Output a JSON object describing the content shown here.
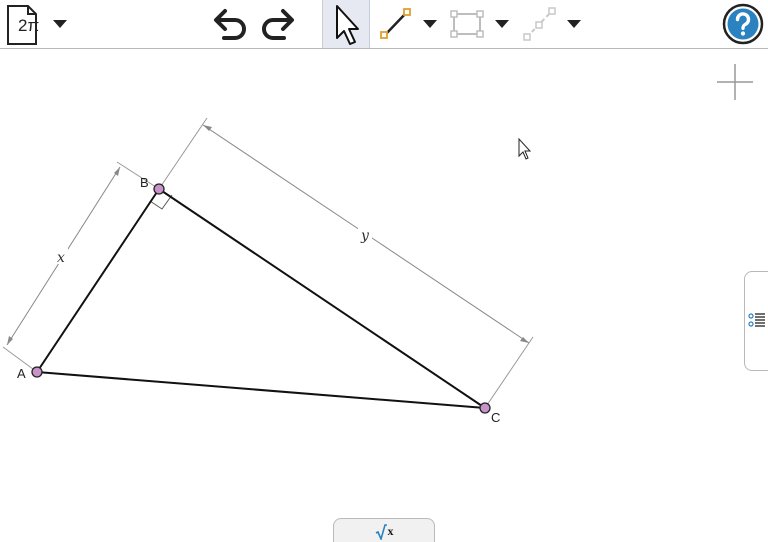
{
  "toolbar": {
    "document_label": "2π",
    "document_menu": "chevron-down-icon",
    "undo": "undo-icon",
    "redo": "redo-icon",
    "select_tool": "arrow-pointer-icon",
    "segment_tool": "segment-tool-icon",
    "transform_tool": "transform-tool-icon",
    "construct_tool": "construct-tool-icon",
    "help": "help-icon",
    "active_tool": "select"
  },
  "canvas": {
    "points": [
      {
        "name": "A",
        "color": "#c893c8"
      },
      {
        "name": "B",
        "color": "#c893c8"
      },
      {
        "name": "C",
        "color": "#c893c8"
      }
    ],
    "segments": [
      "AB",
      "BC",
      "CA"
    ],
    "right_angle_at": "B",
    "measurements": [
      {
        "label": "x",
        "side": "AB"
      },
      {
        "label": "y",
        "side": "BC"
      }
    ],
    "zoom_button": "plus-icon"
  },
  "side_panel": {
    "icon": "list-panel-icon"
  },
  "bottom_panel": {
    "label": "x",
    "icon": "sqrt-icon"
  },
  "colors": {
    "accent": "#2a82c0",
    "point_fill": "#c893c8",
    "segment": "#111111",
    "dimension": "#888888",
    "toolbar_active": "#e6e8f2"
  }
}
